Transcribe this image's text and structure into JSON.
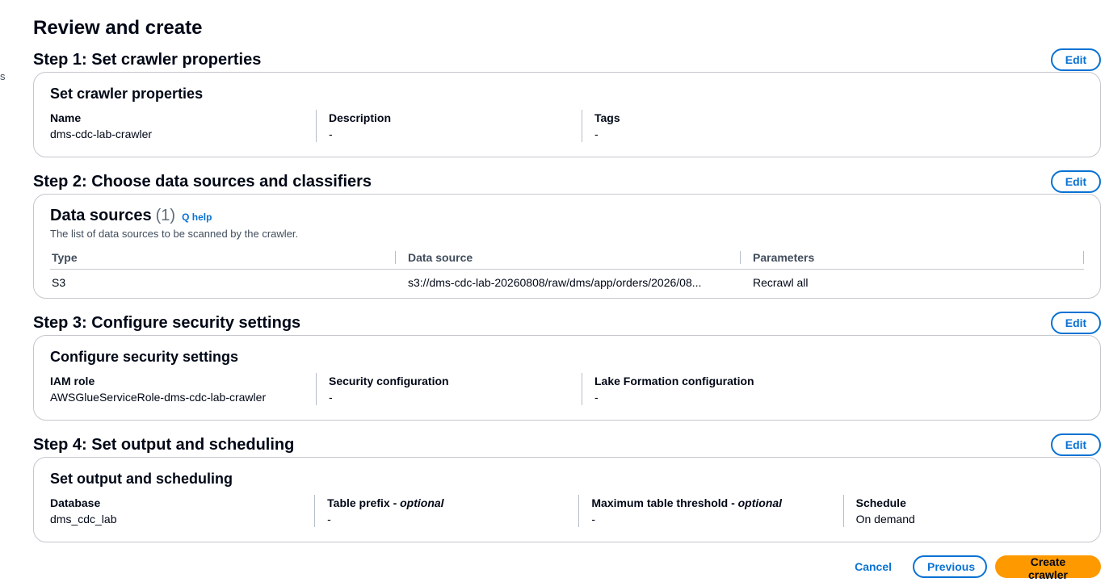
{
  "edge_text": "s",
  "page_title": "Review and create",
  "edit_label": "Edit",
  "steps": [
    {
      "title": "Step 1: Set crawler properties",
      "card_title": "Set crawler properties",
      "fields": [
        {
          "label": "Name",
          "value": "dms-cdc-lab-crawler"
        },
        {
          "label": "Description",
          "value": "-"
        },
        {
          "label": "Tags",
          "value": "-"
        }
      ]
    },
    {
      "title": "Step 2: Choose data sources and classifiers",
      "data_sources": {
        "title": "Data sources",
        "count": "(1)",
        "info_link": "Q help",
        "description": "The list of data sources to be scanned by the crawler.",
        "columns": [
          "Type",
          "Data source",
          "Parameters"
        ],
        "rows": [
          {
            "type": "S3",
            "source": "s3://dms-cdc-lab-20260808/raw/dms/app/orders/2026/08...",
            "parameters": "Recrawl all"
          }
        ]
      }
    },
    {
      "title": "Step 3: Configure security settings",
      "card_title": "Configure security settings",
      "fields": [
        {
          "label": "IAM role",
          "value": "AWSGlueServiceRole-dms-cdc-lab-crawler"
        },
        {
          "label": "Security configuration",
          "value": "-"
        },
        {
          "label": "Lake Formation configuration",
          "value": "-"
        }
      ]
    },
    {
      "title": "Step 4: Set output and scheduling",
      "card_title": "Set output and scheduling",
      "fields": [
        {
          "label": "Database",
          "optional": "",
          "value": "dms_cdc_lab"
        },
        {
          "label": "Table prefix - ",
          "optional": "optional",
          "value": "-"
        },
        {
          "label": "Maximum table threshold - ",
          "optional": "optional",
          "value": "-"
        },
        {
          "label": "Schedule",
          "optional": "",
          "value": "On demand"
        }
      ]
    }
  ],
  "footer": {
    "cancel": "Cancel",
    "previous": "Previous",
    "create": "Create crawler"
  }
}
